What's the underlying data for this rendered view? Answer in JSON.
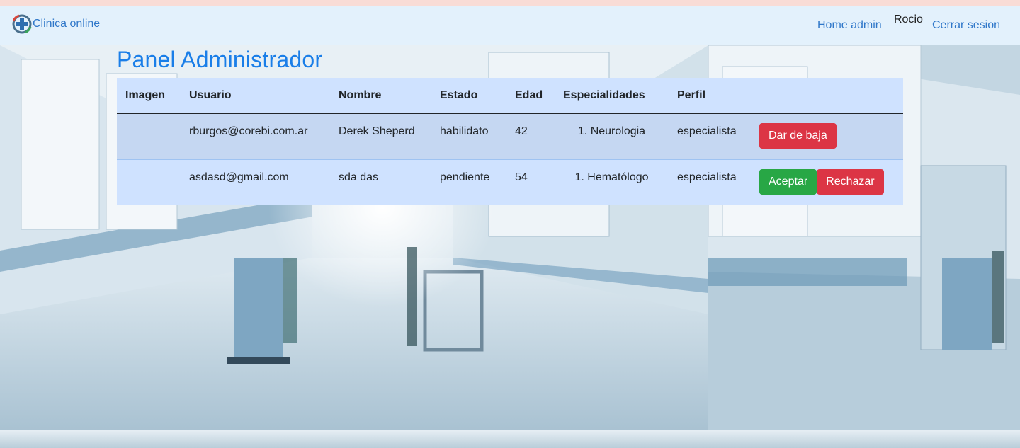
{
  "navbar": {
    "brand": "Clinica online",
    "links": {
      "home": "Home admin",
      "logout": "Cerrar sesion"
    },
    "user": "Rocio"
  },
  "page": {
    "title": "Panel Administrador"
  },
  "table": {
    "headers": [
      "Imagen",
      "Usuario",
      "Nombre",
      "Estado",
      "Edad",
      "Especialidades",
      "Perfil",
      ""
    ],
    "rows": [
      {
        "imagen": "",
        "usuario": "rburgos@corebi.com.ar",
        "nombre": "Derek Sheperd",
        "estado": "habilidato",
        "edad": "42",
        "especialidades": "1. Neurologia",
        "perfil": "especialista",
        "actions": [
          "Dar de baja"
        ]
      },
      {
        "imagen": "",
        "usuario": "asdasd@gmail.com",
        "nombre": "sda das",
        "estado": "pendiente",
        "edad": "54",
        "especialidades": "1. Hematólogo",
        "perfil": "especialista",
        "actions": [
          "Aceptar",
          "Rechazar"
        ]
      }
    ]
  },
  "colors": {
    "accent": "#1a7ee8",
    "link": "#2f77c9",
    "danger": "#dc3545",
    "success": "#28a745",
    "table_header": "#cfe2ff"
  },
  "icons": {
    "brand_logo": "medical-cross-logo-icon"
  }
}
